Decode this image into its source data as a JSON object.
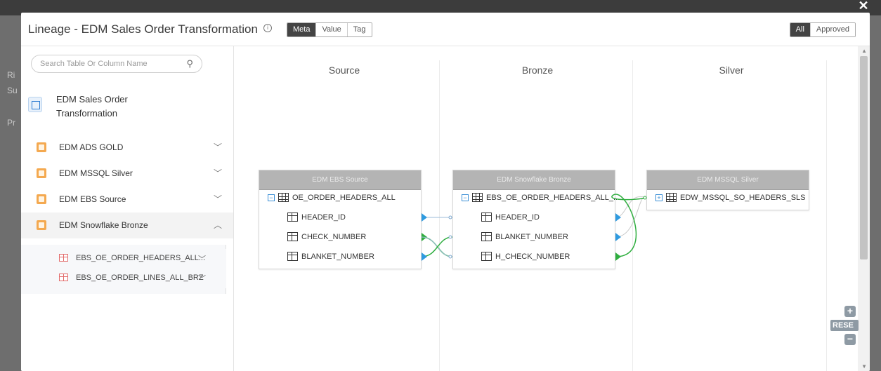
{
  "modal": {
    "title": "Lineage - EDM Sales Order Transformation",
    "view_tabs": [
      "Meta",
      "Value",
      "Tag"
    ],
    "active_view": "Meta",
    "filter_tabs": [
      "All",
      "Approved"
    ],
    "active_filter": "All"
  },
  "background": {
    "left_letters": [
      "Ri",
      "Su",
      "Pr"
    ]
  },
  "sidebar": {
    "search_placeholder": "Search Table Or Column Name",
    "root_label": "EDM Sales Order Transformation",
    "datasources": [
      {
        "label": "EDM ADS GOLD",
        "expanded": false
      },
      {
        "label": "EDM MSSQL Silver",
        "expanded": false
      },
      {
        "label": "EDM EBS Source",
        "expanded": false
      },
      {
        "label": "EDM Snowflake Bronze",
        "expanded": true
      }
    ],
    "tables": [
      {
        "label": "EBS_OE_ORDER_HEADERS_ALL..."
      },
      {
        "label": "EBS_OE_ORDER_LINES_ALL_BRZ"
      }
    ]
  },
  "canvas": {
    "columns": [
      "Source",
      "Bronze",
      "Silver"
    ],
    "nodes": [
      {
        "header": "EDM EBS Source",
        "table": "OE_ORDER_HEADERS_ALL",
        "fields": [
          "HEADER_ID",
          "CHECK_NUMBER",
          "BLANKET_NUMBER"
        ]
      },
      {
        "header": "EDM Snowflake Bronze",
        "table": "EBS_OE_ORDER_HEADERS_ALL_...",
        "fields": [
          "HEADER_ID",
          "BLANKET_NUMBER",
          "H_CHECK_NUMBER"
        ]
      },
      {
        "header": "EDM MSSQL Silver",
        "table": "EDW_MSSQL_SO_HEADERS_SLS",
        "fields": []
      }
    ],
    "reset_label": "RESE"
  },
  "colors": {
    "blue_edge": "#2f9be0",
    "green_edge": "#2fae3f",
    "node_header": "#b4b4b4"
  }
}
